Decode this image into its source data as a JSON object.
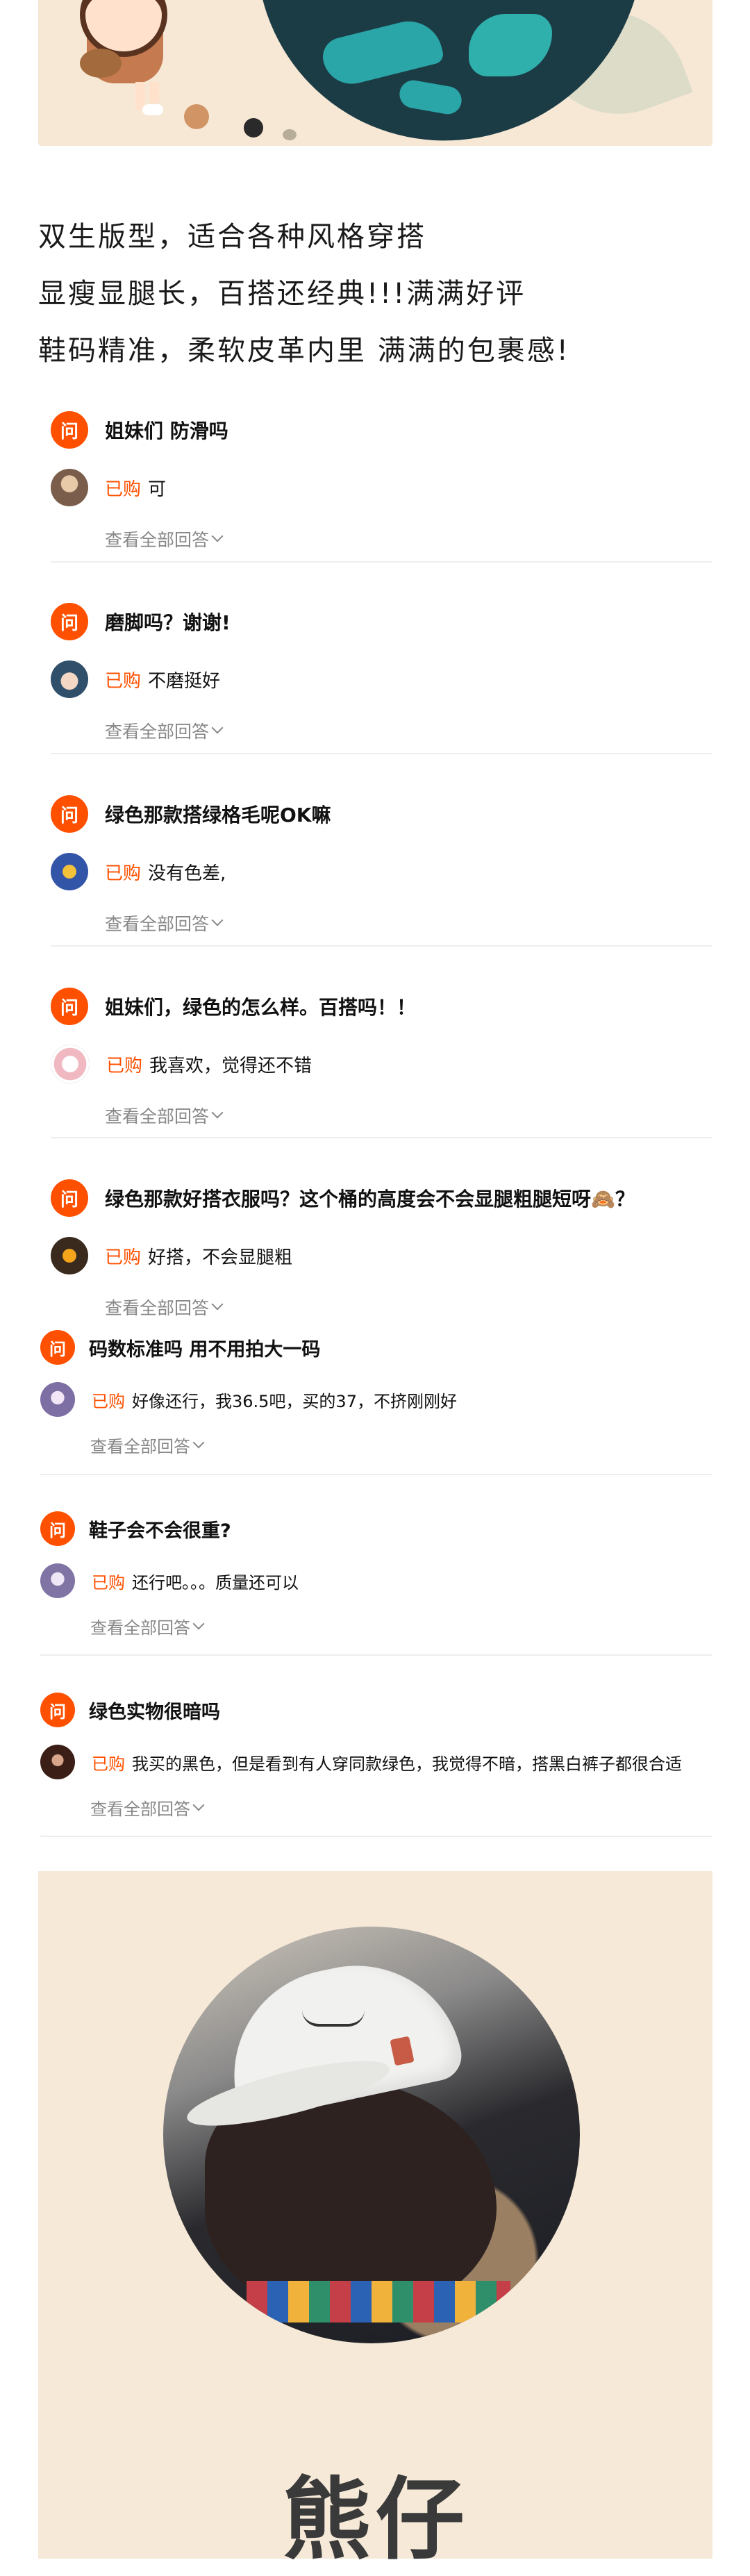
{
  "description": [
    "双生版型，适合各种风格穿搭",
    "显瘦显腿长，百搭还经典!!!满满好评",
    "鞋码精准，柔软皮革内里 满满的包裹感!"
  ],
  "qa_labels": {
    "question_badge": "问",
    "bought_tag": "已购",
    "view_all": "查看全部回答"
  },
  "questions": [
    {
      "question": "姐妹们 防滑吗",
      "answer": "可"
    },
    {
      "question": "磨脚吗？谢谢!",
      "answer": "不磨挺好"
    },
    {
      "question": "绿色那款搭绿格毛呢OK嘛",
      "answer": "没有色差,"
    },
    {
      "question": "姐妹们，绿色的怎么样。百搭吗！！",
      "answer": "我喜欢，觉得还不错"
    },
    {
      "question": "绿色那款好搭衣服吗？这个桶的高度会不会显腿粗腿短呀🙈？",
      "answer": "好搭，不会显腿粗"
    },
    {
      "question": "码数标准吗 用不用拍大一码",
      "answer": "好像还行，我36.5吧，买的37，不挤刚刚好"
    },
    {
      "question": "鞋子会不会很重?",
      "answer": "还行吧。。。质量还可以"
    },
    {
      "question": "绿色实物很暗吗",
      "answer": "我买的黑色，但是看到有人穿同款绿色，我觉得不暗，搭黑白裤子都很合适"
    }
  ],
  "model_card": {
    "name": "熊仔"
  },
  "colors": {
    "accent": "#ff5000",
    "muted": "#888888",
    "card_bg": "#f6e9d8"
  }
}
